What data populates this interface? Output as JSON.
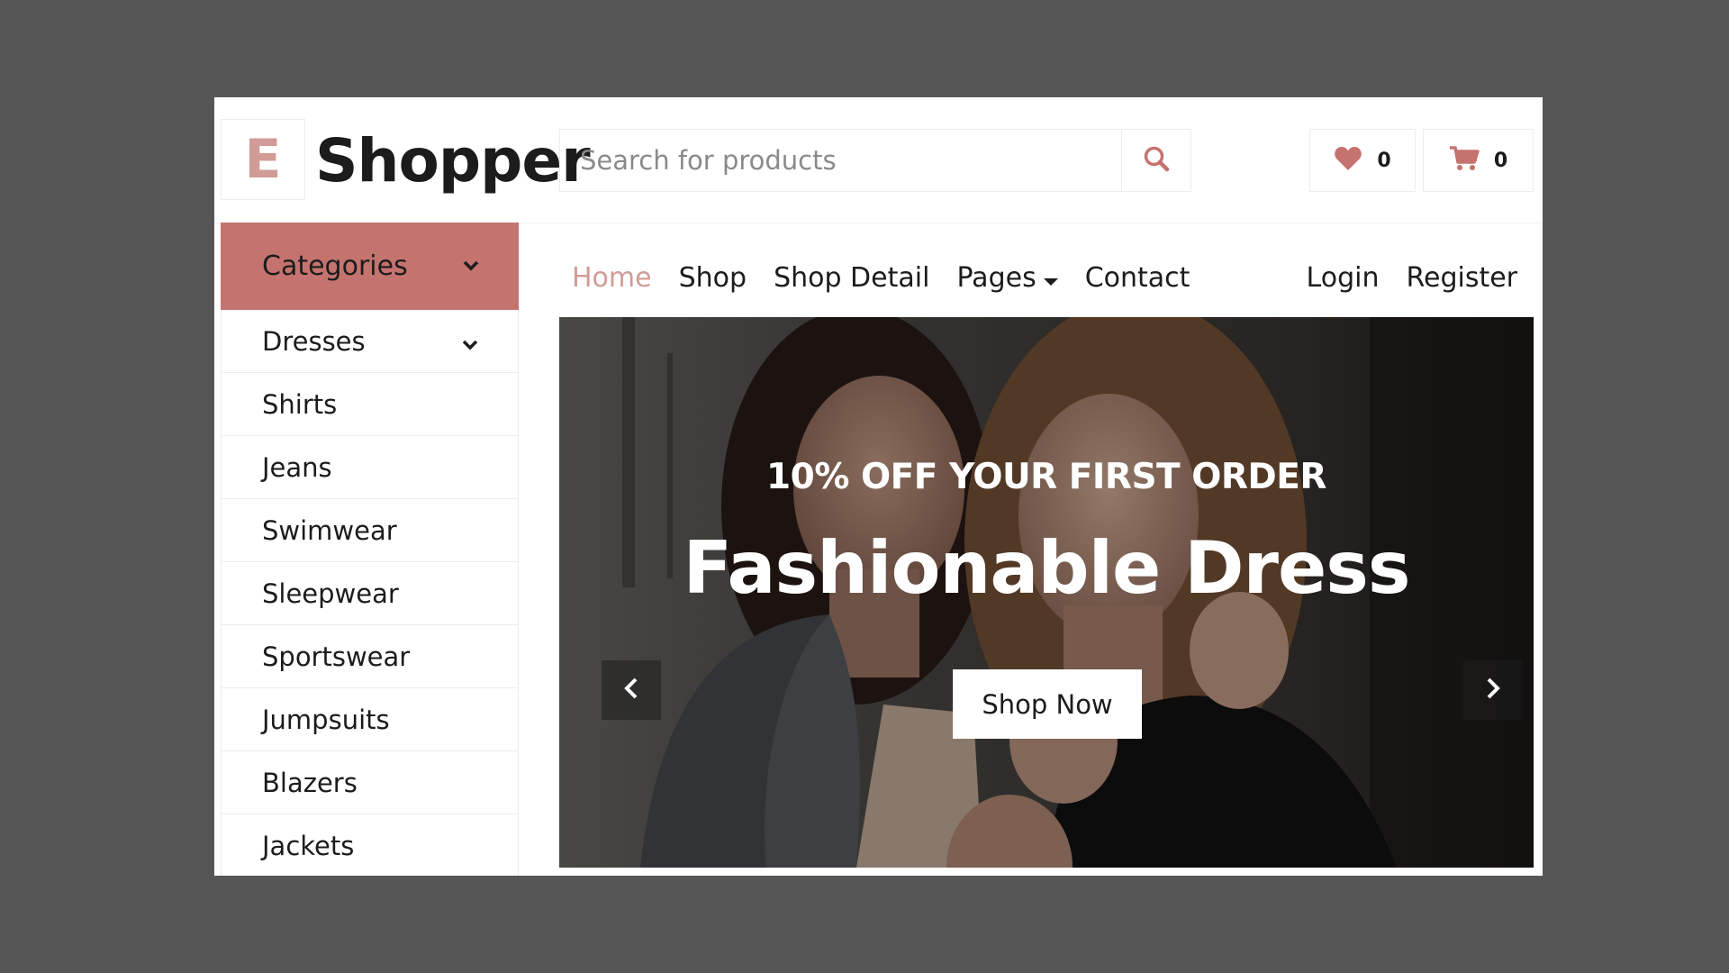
{
  "brand": {
    "logo_letter": "E",
    "name": "Shopper",
    "accent_color": "#d19c97",
    "category_bar_color": "#c5736f"
  },
  "search": {
    "placeholder": "Search for products",
    "value": "",
    "icon": "search-icon"
  },
  "header_actions": {
    "wishlist": {
      "icon": "heart-icon",
      "count": "0"
    },
    "cart": {
      "icon": "shopping-cart-icon",
      "count": "0"
    }
  },
  "categories": {
    "title": "Categories",
    "items": [
      {
        "label": "Dresses",
        "has_submenu": true
      },
      {
        "label": "Shirts"
      },
      {
        "label": "Jeans"
      },
      {
        "label": "Swimwear"
      },
      {
        "label": "Sleepwear"
      },
      {
        "label": "Sportswear"
      },
      {
        "label": "Jumpsuits"
      },
      {
        "label": "Blazers"
      },
      {
        "label": "Jackets"
      }
    ]
  },
  "nav": {
    "items": [
      {
        "label": "Home",
        "active": true
      },
      {
        "label": "Shop"
      },
      {
        "label": "Shop Detail"
      },
      {
        "label": "Pages",
        "dropdown": true
      },
      {
        "label": "Contact"
      }
    ],
    "auth": {
      "login": "Login",
      "register": "Register"
    }
  },
  "hero": {
    "subtitle": "10% OFF YOUR FIRST ORDER",
    "title": "Fashionable Dress",
    "button": "Shop Now"
  }
}
